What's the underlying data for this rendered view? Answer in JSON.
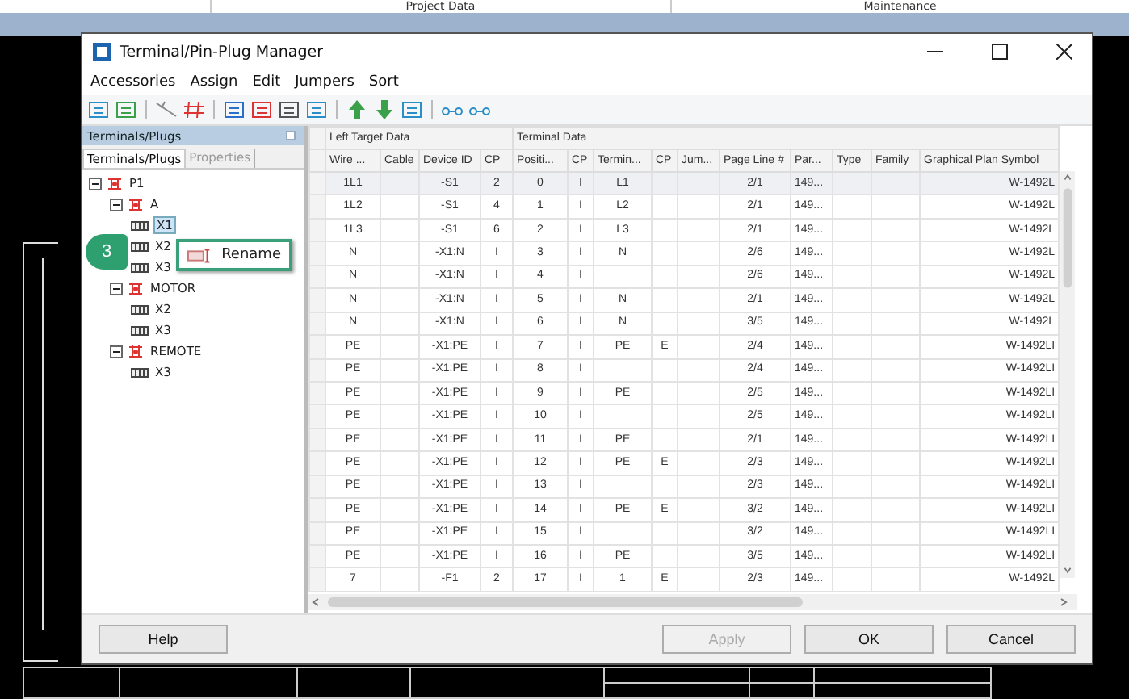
{
  "background_tabs": [
    "Project Data",
    "Maintenance"
  ],
  "window": {
    "title": "Terminal/Pin-Plug Manager"
  },
  "menu": [
    "Accessories",
    "Assign",
    "Edit",
    "Jumpers",
    "Sort"
  ],
  "panel": {
    "title": "Terminals/Plugs",
    "tabs": [
      {
        "label": "Terminals/Plugs",
        "selected": true
      },
      {
        "label": "Properties",
        "selected": false
      }
    ]
  },
  "tree": [
    {
      "kind": "group",
      "label": "P1",
      "expanded": true,
      "selected": false,
      "children": [
        {
          "kind": "group",
          "label": "A",
          "expanded": true,
          "selected": false,
          "children": [
            {
              "kind": "terminal",
              "label": "X1",
              "selected": true
            },
            {
              "kind": "terminal",
              "label": "X2",
              "selected": false
            },
            {
              "kind": "terminal",
              "label": "X3",
              "selected": false
            }
          ]
        },
        {
          "kind": "group",
          "label": "MOTOR",
          "expanded": true,
          "selected": false,
          "children": [
            {
              "kind": "terminal",
              "label": "X2",
              "selected": false
            },
            {
              "kind": "terminal",
              "label": "X3",
              "selected": false
            }
          ]
        },
        {
          "kind": "group",
          "label": "REMOTE",
          "expanded": true,
          "selected": false,
          "children": [
            {
              "kind": "terminal",
              "label": "X3",
              "selected": false
            }
          ]
        }
      ]
    }
  ],
  "context_menu": {
    "step": "3",
    "items": [
      "Rename"
    ]
  },
  "table": {
    "groups": [
      {
        "label": "Left Target Data"
      },
      {
        "label": "Terminal Data"
      }
    ],
    "columns": [
      "Wire ...",
      "Cable",
      "Device ID",
      "CP",
      "Positi...",
      "CP",
      "Termin...",
      "CP",
      "Jum...",
      "Page Line #",
      "Par...",
      "Type",
      "Family",
      "Graphical Plan Symbol"
    ],
    "rows": [
      {
        "selected": true,
        "cells": [
          "1L1",
          "",
          "-S1",
          "2",
          "0",
          "I",
          "L1",
          "",
          "",
          "2/1",
          "149...",
          "",
          "",
          "W-1492L"
        ]
      },
      {
        "selected": false,
        "cells": [
          "1L2",
          "",
          "-S1",
          "4",
          "1",
          "I",
          "L2",
          "",
          "",
          "2/1",
          "149...",
          "",
          "",
          "W-1492L"
        ]
      },
      {
        "selected": false,
        "cells": [
          "1L3",
          "",
          "-S1",
          "6",
          "2",
          "I",
          "L3",
          "",
          "",
          "2/1",
          "149...",
          "",
          "",
          "W-1492L"
        ]
      },
      {
        "selected": false,
        "cells": [
          "N",
          "",
          "-X1:N",
          "I",
          "3",
          "I",
          "N",
          "",
          "",
          "2/6",
          "149...",
          "",
          "",
          "W-1492L"
        ]
      },
      {
        "selected": false,
        "cells": [
          "N",
          "",
          "-X1:N",
          "I",
          "4",
          "I",
          "",
          "",
          "",
          "2/6",
          "149...",
          "",
          "",
          "W-1492L"
        ]
      },
      {
        "selected": false,
        "cells": [
          "N",
          "",
          "-X1:N",
          "I",
          "5",
          "I",
          "N",
          "",
          "",
          "2/1",
          "149...",
          "",
          "",
          "W-1492L"
        ]
      },
      {
        "selected": false,
        "cells": [
          "N",
          "",
          "-X1:N",
          "I",
          "6",
          "I",
          "N",
          "",
          "",
          "3/5",
          "149...",
          "",
          "",
          "W-1492L"
        ]
      },
      {
        "selected": false,
        "cells": [
          "PE",
          "",
          "-X1:PE",
          "I",
          "7",
          "I",
          "PE",
          "E",
          "",
          "2/4",
          "149...",
          "",
          "",
          "W-1492LI"
        ]
      },
      {
        "selected": false,
        "cells": [
          "PE",
          "",
          "-X1:PE",
          "I",
          "8",
          "I",
          "",
          "",
          "",
          "2/4",
          "149...",
          "",
          "",
          "W-1492LI"
        ]
      },
      {
        "selected": false,
        "cells": [
          "PE",
          "",
          "-X1:PE",
          "I",
          "9",
          "I",
          "PE",
          "",
          "",
          "2/5",
          "149...",
          "",
          "",
          "W-1492LI"
        ]
      },
      {
        "selected": false,
        "cells": [
          "PE",
          "",
          "-X1:PE",
          "I",
          "10",
          "I",
          "",
          "",
          "",
          "2/5",
          "149...",
          "",
          "",
          "W-1492LI"
        ]
      },
      {
        "selected": false,
        "cells": [
          "PE",
          "",
          "-X1:PE",
          "I",
          "11",
          "I",
          "PE",
          "",
          "",
          "2/1",
          "149...",
          "",
          "",
          "W-1492LI"
        ]
      },
      {
        "selected": false,
        "cells": [
          "PE",
          "",
          "-X1:PE",
          "I",
          "12",
          "I",
          "PE",
          "E",
          "",
          "2/3",
          "149...",
          "",
          "",
          "W-1492LI"
        ]
      },
      {
        "selected": false,
        "cells": [
          "PE",
          "",
          "-X1:PE",
          "I",
          "13",
          "I",
          "",
          "",
          "",
          "2/3",
          "149...",
          "",
          "",
          "W-1492LI"
        ]
      },
      {
        "selected": false,
        "cells": [
          "PE",
          "",
          "-X1:PE",
          "I",
          "14",
          "I",
          "PE",
          "E",
          "",
          "3/2",
          "149...",
          "",
          "",
          "W-1492LI"
        ]
      },
      {
        "selected": false,
        "cells": [
          "PE",
          "",
          "-X1:PE",
          "I",
          "15",
          "I",
          "",
          "",
          "",
          "3/2",
          "149...",
          "",
          "",
          "W-1492LI"
        ]
      },
      {
        "selected": false,
        "cells": [
          "PE",
          "",
          "-X1:PE",
          "I",
          "16",
          "I",
          "PE",
          "",
          "",
          "3/5",
          "149...",
          "",
          "",
          "W-1492LI"
        ]
      },
      {
        "selected": false,
        "cells": [
          "7",
          "",
          "-F1",
          "2",
          "17",
          "I",
          "1",
          "E",
          "",
          "2/3",
          "149...",
          "",
          "",
          "W-1492L"
        ]
      }
    ]
  },
  "buttons": [
    {
      "label": "Help",
      "disabled": false
    },
    {
      "label": "Apply",
      "disabled": true
    },
    {
      "label": "OK",
      "disabled": false
    },
    {
      "label": "Cancel",
      "disabled": false
    }
  ]
}
